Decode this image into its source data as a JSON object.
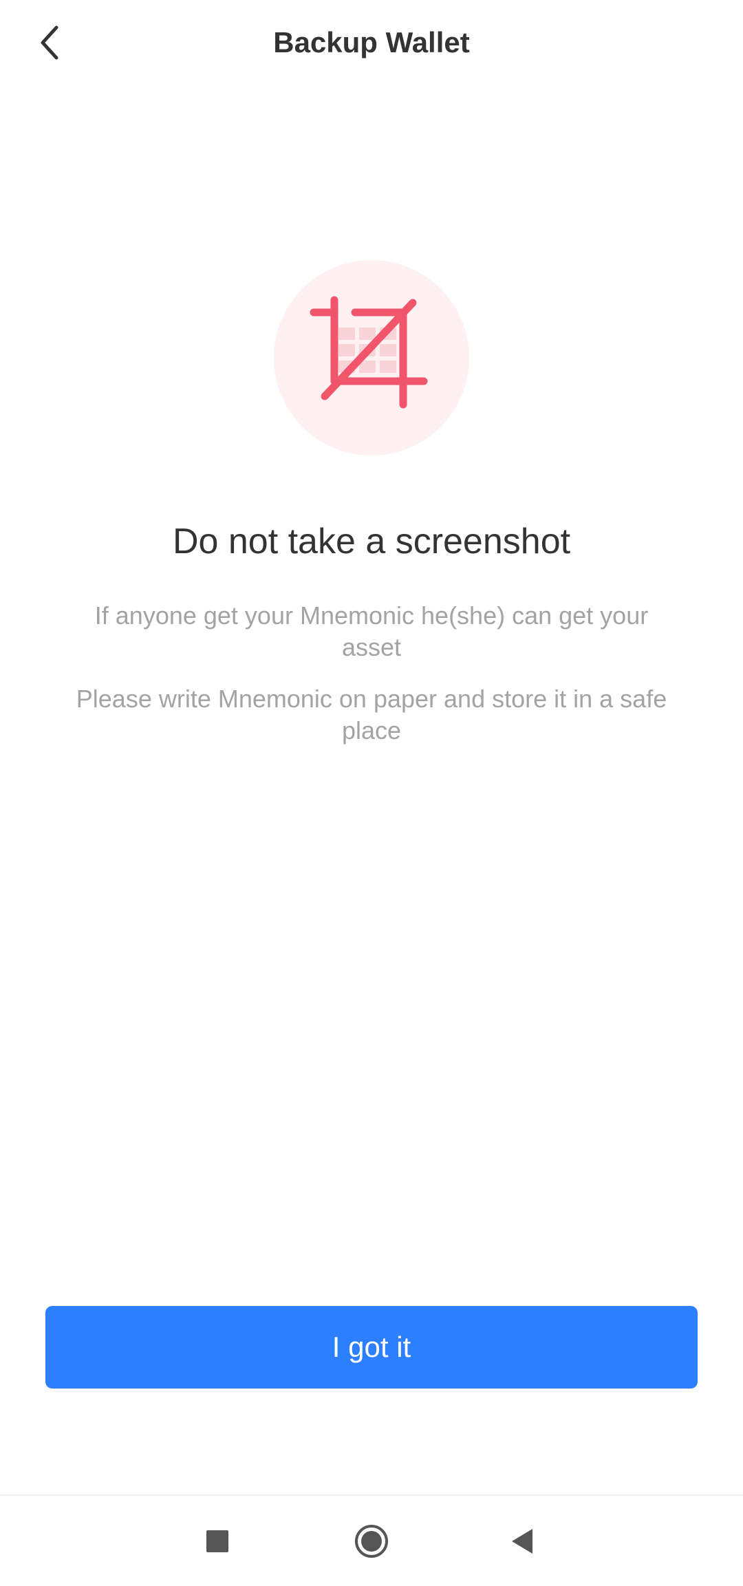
{
  "header": {
    "title": "Backup Wallet",
    "back_icon": "chevron-left-icon"
  },
  "hero": {
    "icon": "no-screenshot-icon",
    "accent_color": "#f0556b",
    "background_color": "#fff0f1"
  },
  "content": {
    "heading": "Do not take a screenshot",
    "warning_1": "If anyone get your Mnemonic he(she) can get your asset",
    "warning_2": "Please write Mnemonic on paper and store it in a safe place"
  },
  "actions": {
    "confirm_label": "I got it",
    "confirm_color": "#2c80ff"
  },
  "system_nav": {
    "recents_icon": "square-icon",
    "home_icon": "circle-icon",
    "back_icon": "triangle-back-icon"
  }
}
